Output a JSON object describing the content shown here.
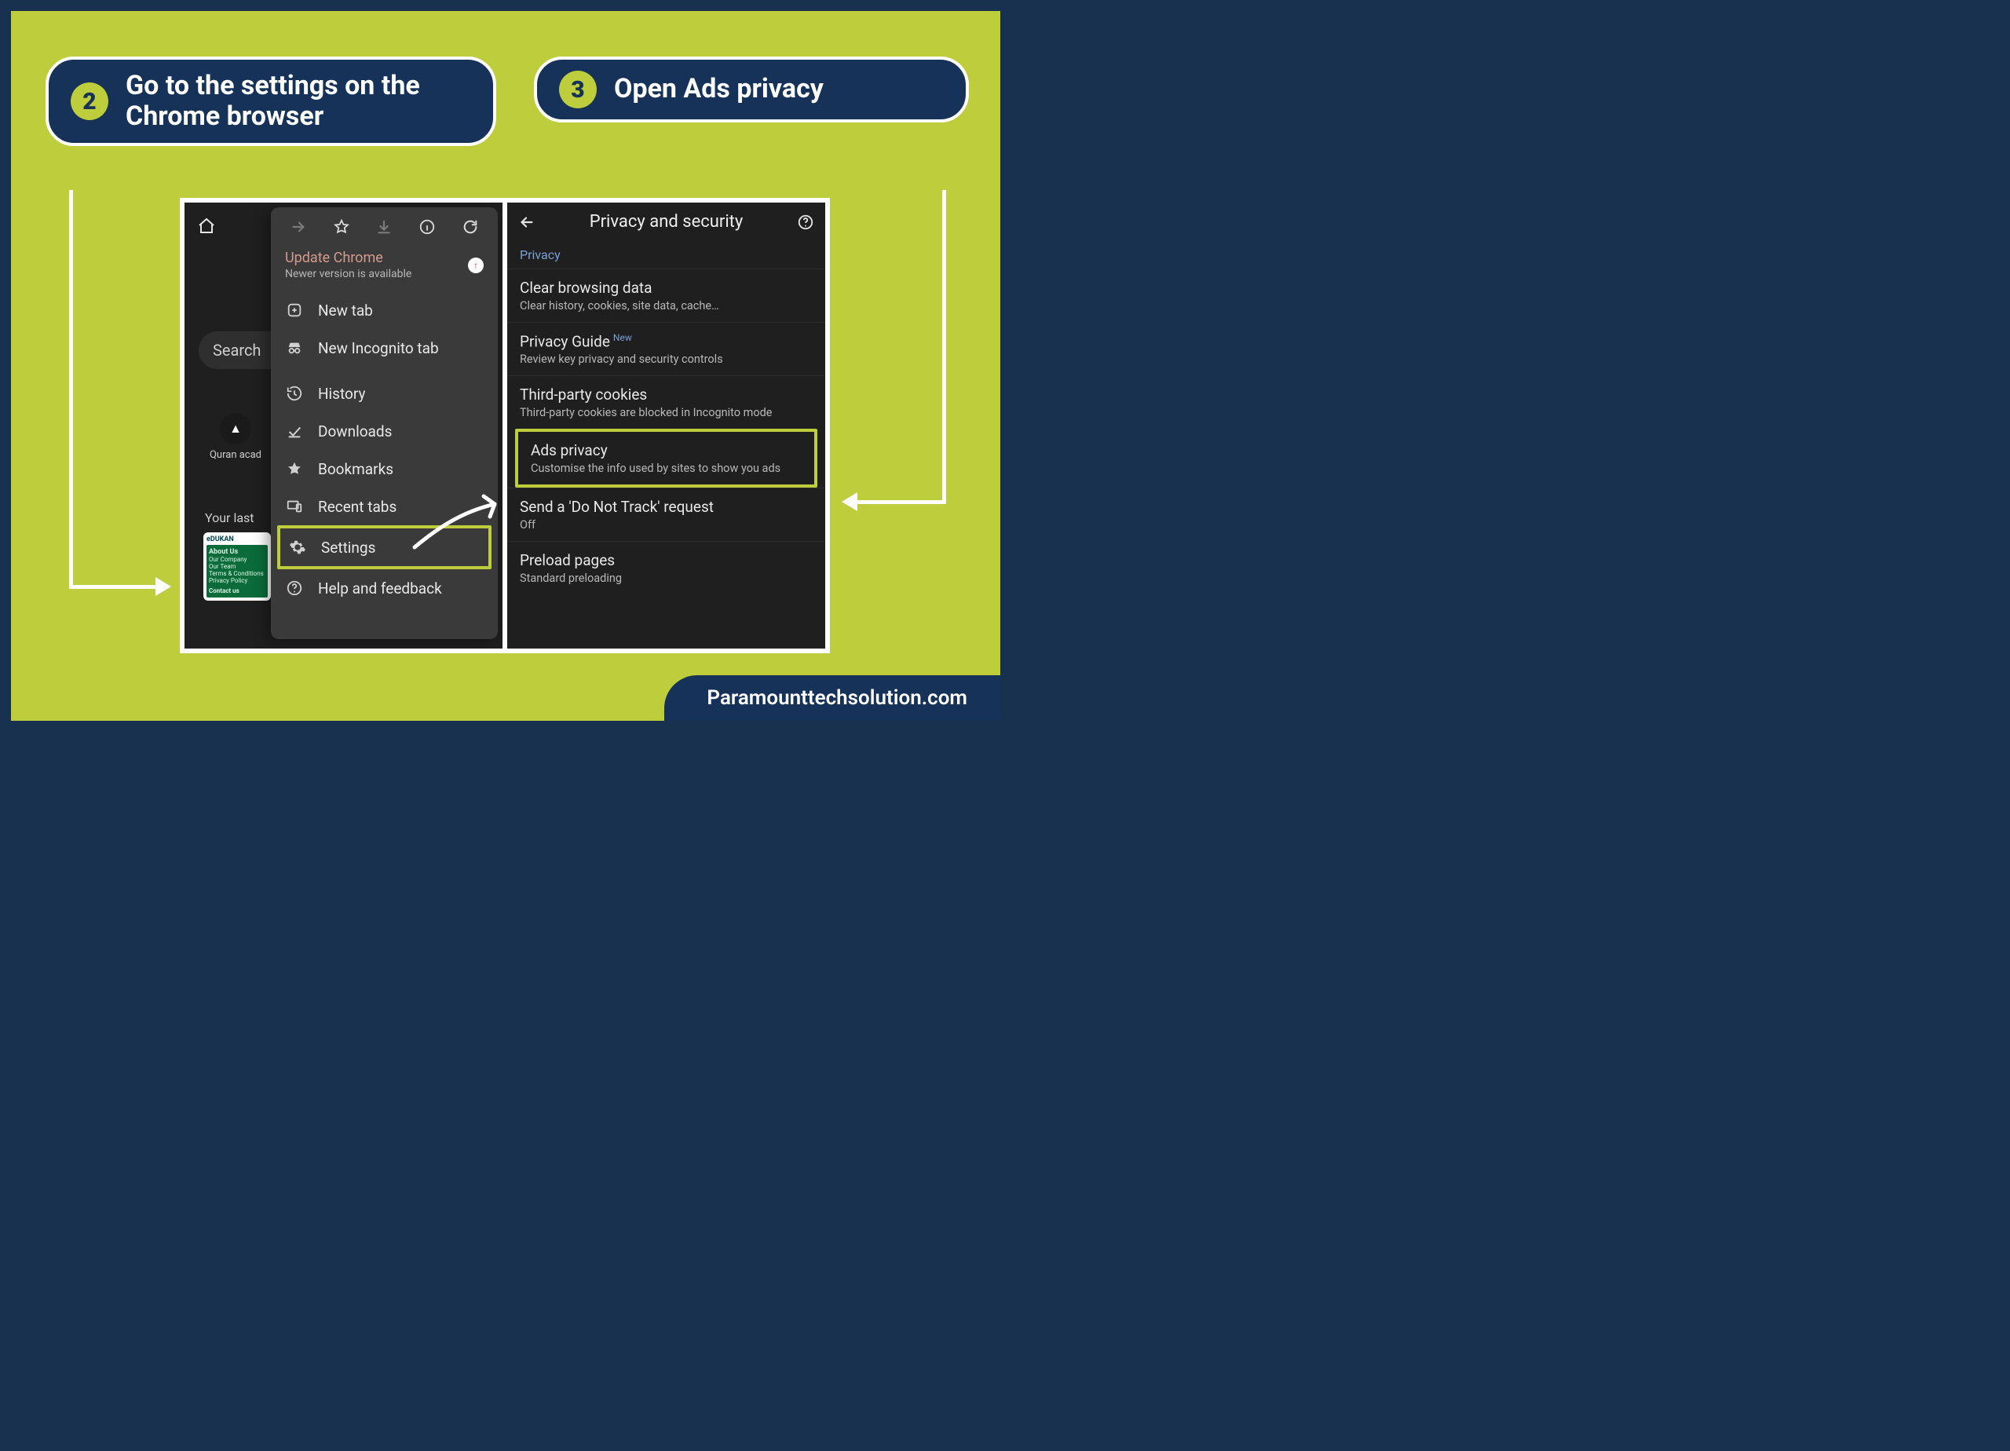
{
  "steps": {
    "two": {
      "num": "2",
      "text": "Go to the settings on the Chrome browser"
    },
    "three": {
      "num": "3",
      "text": "Open Ads privacy"
    }
  },
  "left_screen": {
    "search_pill": "Search",
    "app_label": "Quran acad",
    "section_title": "Your last",
    "card": {
      "brand": "eDUKAN",
      "about": "About Us",
      "l1": "Our Company",
      "l2": "Our Team",
      "l3": "Terms & Conditions",
      "l4": "Privacy Policy",
      "contact": "Contact us"
    },
    "update": {
      "title": "Update Chrome",
      "subtitle": "Newer version is available"
    },
    "menu": {
      "new_tab": "New tab",
      "incognito": "New Incognito tab",
      "history": "History",
      "downloads": "Downloads",
      "bookmarks": "Bookmarks",
      "recent": "Recent tabs",
      "settings": "Settings",
      "help": "Help and feedback"
    }
  },
  "right_screen": {
    "title": "Privacy and security",
    "subhead": "Privacy",
    "items": {
      "clear": {
        "title": "Clear browsing data",
        "sub": "Clear history, cookies, site data, cache…"
      },
      "guide": {
        "title": "Privacy Guide",
        "badge": "New",
        "sub": "Review key privacy and security controls"
      },
      "cookies": {
        "title": "Third-party cookies",
        "sub": "Third-party cookies are blocked in Incognito mode"
      },
      "ads": {
        "title": "Ads privacy",
        "sub": "Customise the info used by sites to show you ads"
      },
      "dnt": {
        "title": "Send a 'Do Not Track' request",
        "sub": "Off"
      },
      "preload": {
        "title": "Preload pages",
        "sub": "Standard preloading"
      }
    }
  },
  "footer": "Paramounttechsolution.com"
}
